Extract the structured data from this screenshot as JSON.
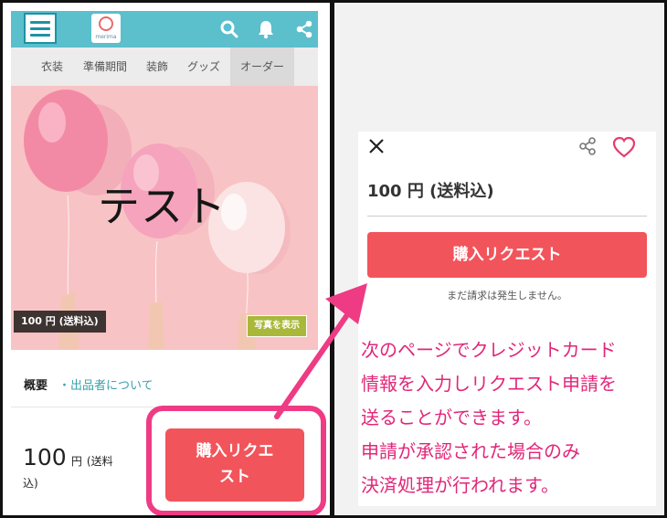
{
  "left_phone": {
    "logo_text": "merima",
    "categories": [
      "衣装",
      "準備期間",
      "装飾",
      "グッズ",
      "オーダー"
    ],
    "hero": {
      "title": "テスト",
      "price_tag": "100 円 (送料込)",
      "photo_button": "写真を表示"
    },
    "overview": {
      "label": "概要",
      "link": "・出品者について"
    },
    "bottom": {
      "price_number": "100",
      "price_unit": "円",
      "price_note_1": "(送料",
      "price_note_2": "込)",
      "buy_button_line1": "購入リクエ",
      "buy_button_line2": "スト"
    }
  },
  "right_modal": {
    "price": "100 円 (送料込)",
    "buy_button": "購入リクエスト",
    "note": "まだ請求は発生しません。",
    "explanation": [
      "次のページでクレジットカード",
      "情報を入力しリクエスト申請を",
      "送ることができます。",
      "申請が承認された場合のみ",
      "決済処理が行われます。"
    ]
  },
  "colors": {
    "topbar": "#5bbfcc",
    "button_red": "#f2545b",
    "annotation_pink": "#ee3b84",
    "link_teal": "#3aa0ab",
    "hero_pink": "#f8c3c4"
  },
  "icons": [
    "menu-icon",
    "logo-icon",
    "search-icon",
    "bell-icon",
    "share-icon",
    "close-icon",
    "heart-icon"
  ]
}
